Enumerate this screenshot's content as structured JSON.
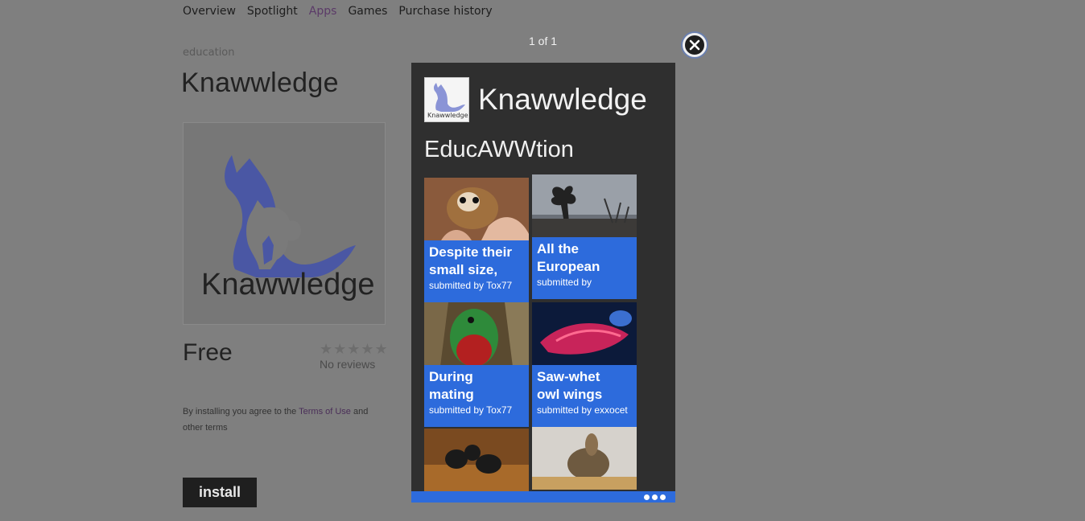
{
  "nav": {
    "items": [
      {
        "label": "Overview"
      },
      {
        "label": "Spotlight"
      },
      {
        "label": "Apps"
      },
      {
        "label": "Games"
      },
      {
        "label": "Purchase history"
      }
    ],
    "active": "Apps",
    "active_color": "#5b3a68"
  },
  "app": {
    "category": "education",
    "title": "Knawwledge",
    "logo_text": "Knawwledge",
    "price": "Free",
    "stars": "★★★★★",
    "reviews": "No reviews",
    "terms_prefix": "By installing you agree to the ",
    "terms_link": "Terms of Use",
    "terms_suffix": " and other terms",
    "install_label": "install"
  },
  "overlay": {
    "counter": "1 of 1",
    "close_icon": "close-icon",
    "phone": {
      "title": "Knawwledge",
      "logo_text": "Knawwledge",
      "subtitle": "EducAWWtion",
      "accent": "#2d6bdc",
      "tiles": [
        {
          "title_1": "Despite their",
          "title_2": "small size,",
          "sub": "submitted by Tox77"
        },
        {
          "title_1": "All the",
          "title_2": "European",
          "sub": "submitted by"
        },
        {
          "title_1": "During",
          "title_2": "mating",
          "sub": "submitted by Tox77"
        },
        {
          "title_1": "Saw-whet",
          "title_2": "owl wings",
          "sub": "submitted by exxocet"
        }
      ]
    }
  }
}
